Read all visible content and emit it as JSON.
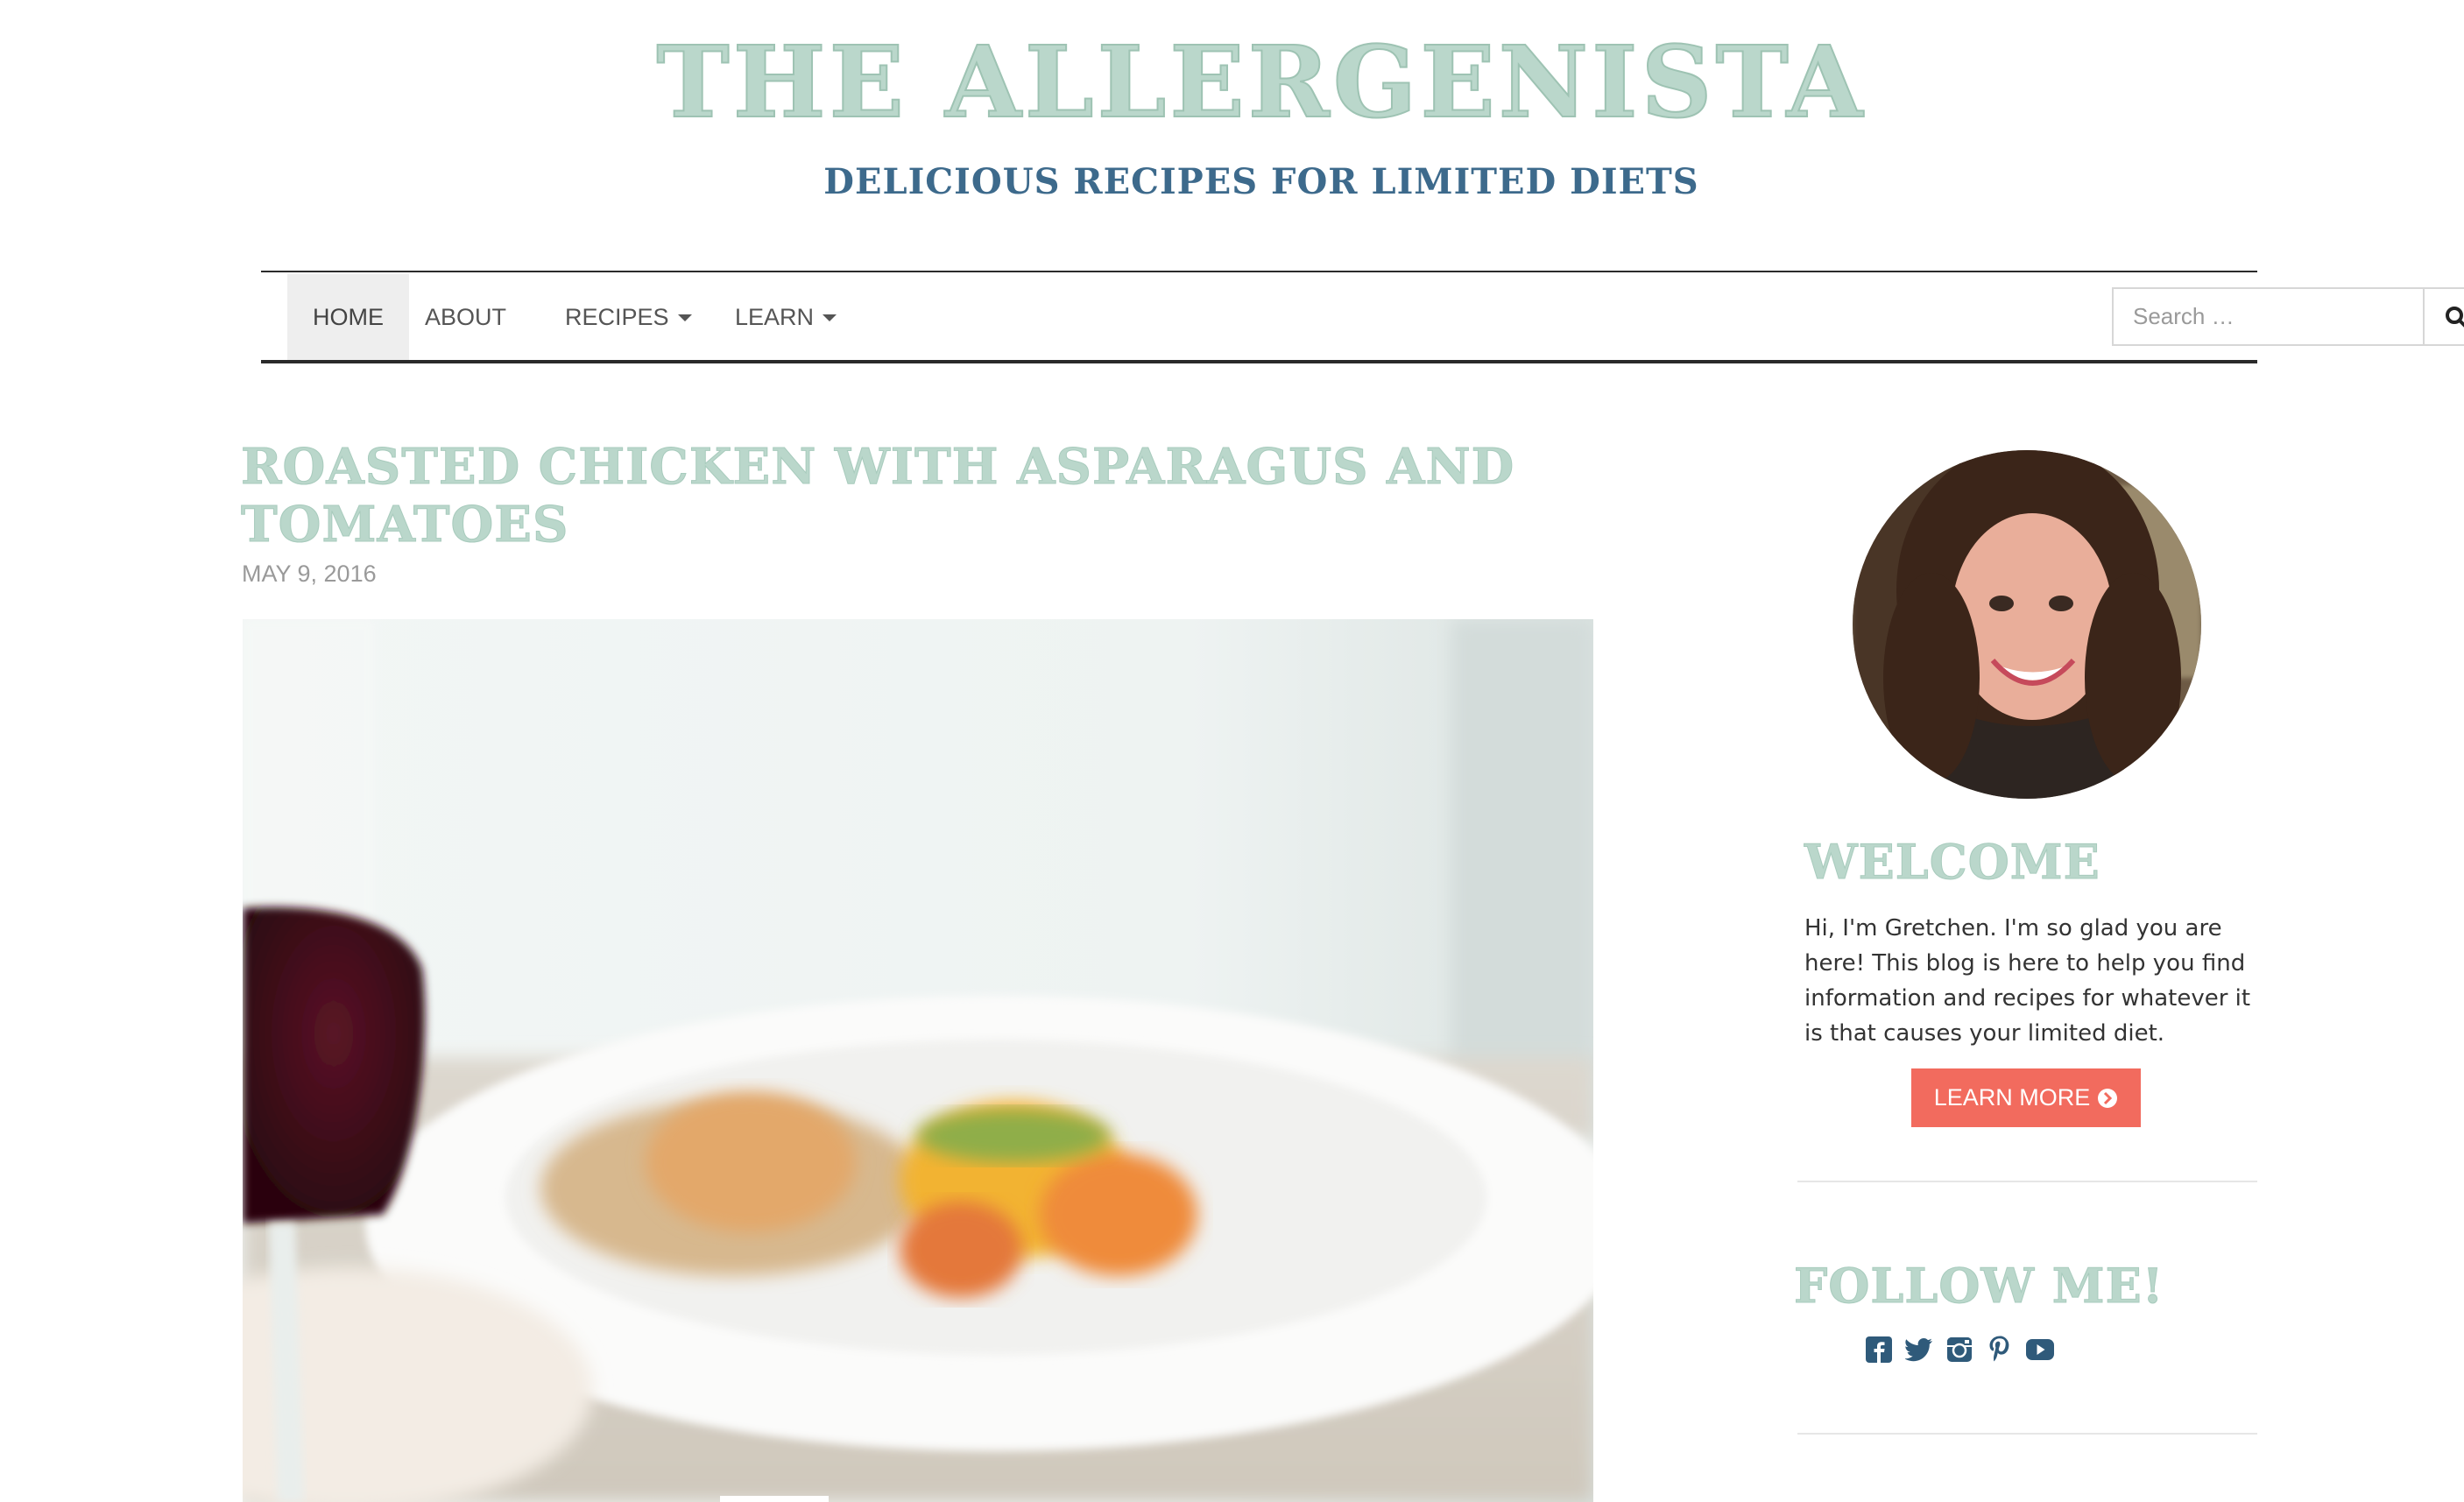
{
  "header": {
    "site_title": "THE ALLERGENISTA",
    "tagline": "DELICIOUS RECIPES FOR LIMITED DIETS"
  },
  "nav": {
    "items": [
      {
        "label": "HOME",
        "active": true,
        "dropdown": false
      },
      {
        "label": "ABOUT",
        "active": false,
        "dropdown": false
      },
      {
        "label": "RECIPES",
        "active": false,
        "dropdown": true
      },
      {
        "label": "LEARN",
        "active": false,
        "dropdown": true
      }
    ],
    "search_placeholder": "Search …",
    "search_icon": "search-icon"
  },
  "post": {
    "title": "ROASTED CHICKEN WITH ASPARAGUS AND TOMATOES",
    "date": "MAY 9, 2016"
  },
  "sidebar": {
    "welcome_title": "WELCOME",
    "welcome_text": "Hi, I'm Gretchen. I'm so glad you are here! This blog is here to help you find information and recipes for whatever it is that causes your limited diet.",
    "learn_more_label": "LEARN MORE",
    "follow_title": "FOLLOW ME!",
    "social_icons": [
      "facebook-icon",
      "twitter-icon",
      "instagram-icon",
      "pinterest-icon",
      "youtube-icon"
    ]
  },
  "colors": {
    "title_green": "#bad7cb",
    "tagline_blue": "#3d6a8c",
    "button_coral": "#f26b5e",
    "social_blue": "#2f5a7a"
  }
}
